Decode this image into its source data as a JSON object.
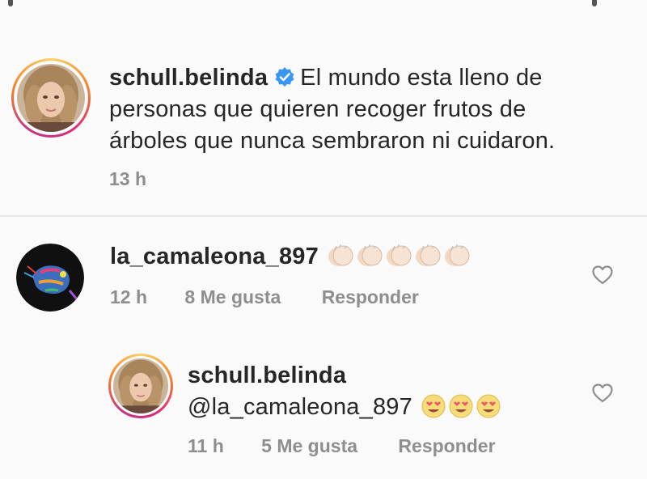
{
  "post": {
    "username": "schull.belinda",
    "caption": "El mundo esta lleno de personas que quieren recoger frutos de árboles que nunca sembraron ni cuidaron.",
    "caption_line1": "El mundo esta lleno de",
    "caption_line2": "personas que quieren recoger frutos de",
    "caption_line3": "árboles que nunca sembraron ni cuidaron.",
    "time": "13 h"
  },
  "comments": [
    {
      "username": "la_camaleona_897",
      "emoji": "clapping-hands x5",
      "time": "12 h",
      "likes": "8 Me gusta",
      "reply_label": "Responder"
    },
    {
      "username": "schull.belinda",
      "mention": "@la_camaleona_897",
      "emoji": "heart-eyes x3",
      "time": "11 h",
      "likes": "5 Me gusta",
      "reply_label": "Responder"
    }
  ],
  "icons": {
    "verified": "verified-badge-icon",
    "like": "heart-icon",
    "clap": "clapping-hands-emoji",
    "heart_eyes": "heart-eyes-emoji"
  },
  "colors": {
    "verified_blue": "#3897f0",
    "meta_gray": "#8e8e8e",
    "text": "#262626"
  }
}
